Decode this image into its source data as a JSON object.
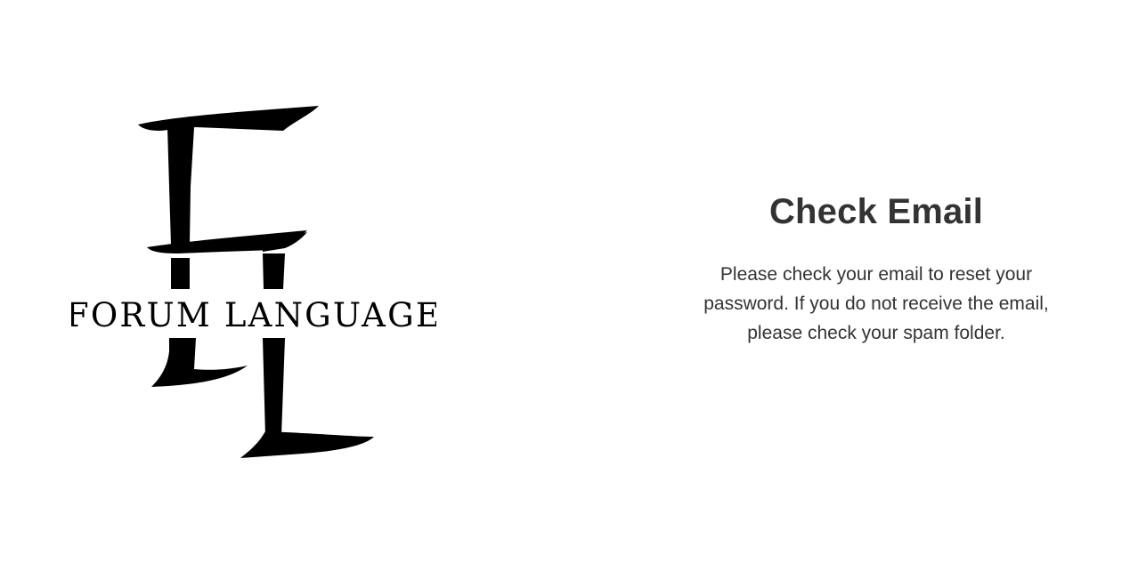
{
  "brand": {
    "logo_monogram": "FL",
    "logo_text": "FORUM LANGUAGE"
  },
  "message": {
    "title": "Check Email",
    "body": "Please check your email to reset your password. If you do not receive the email, please check your spam folder."
  },
  "colors": {
    "background": "#ffffff",
    "text": "#333333",
    "logo": "#000000"
  }
}
